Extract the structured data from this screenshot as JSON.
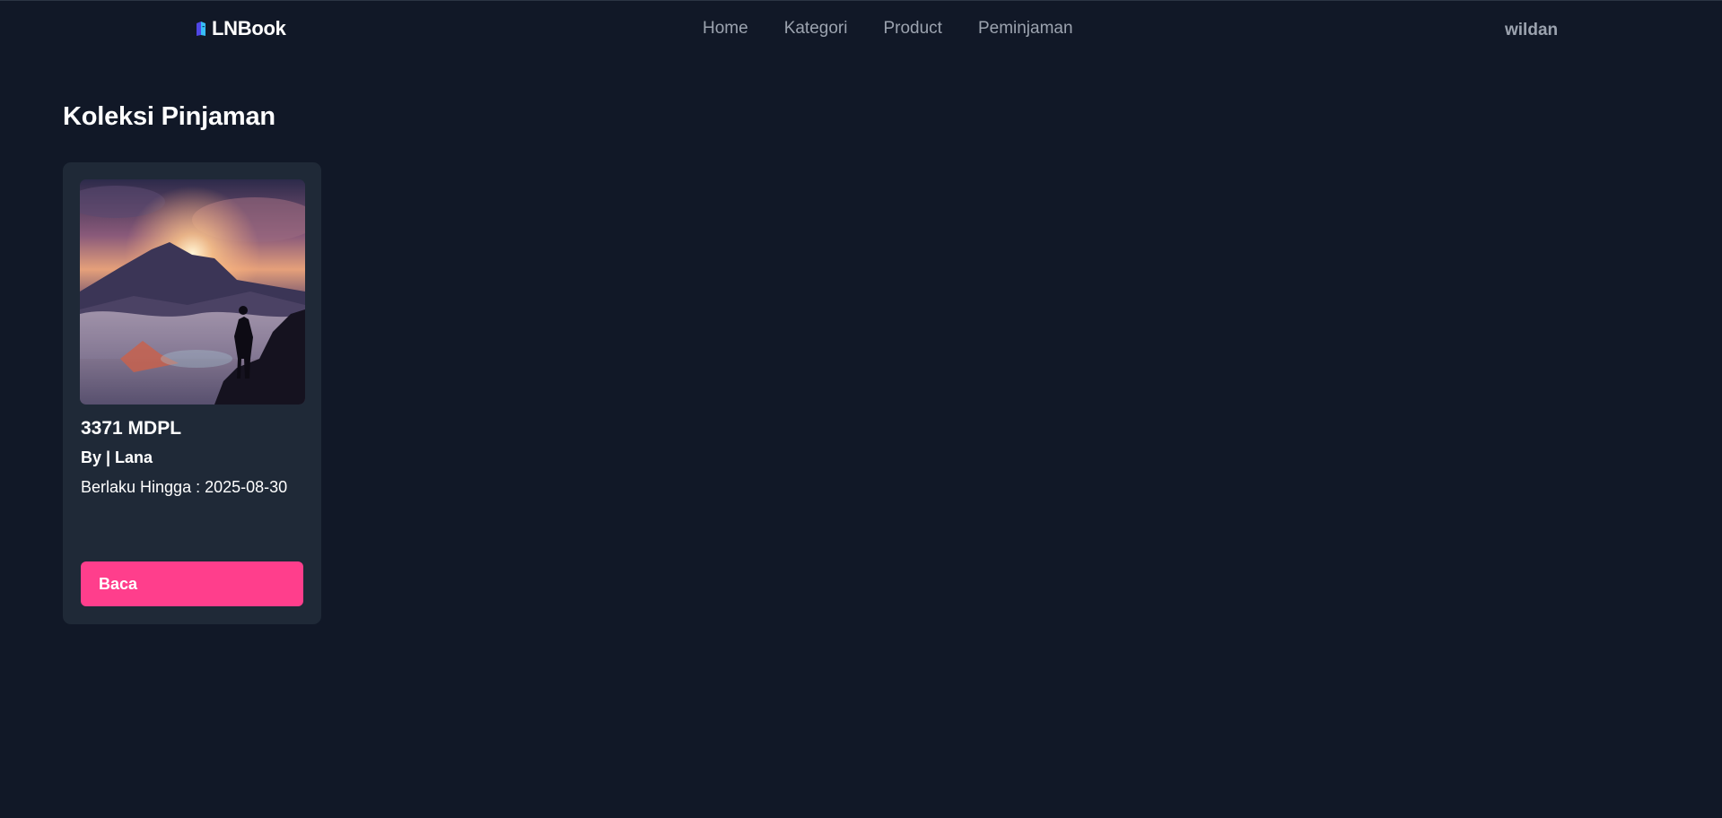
{
  "navbar": {
    "brand": "LNBook",
    "brand_icon": "book-icon",
    "links": [
      "Home",
      "Kategori",
      "Product",
      "Peminjaman"
    ],
    "user": "wildan"
  },
  "main": {
    "title": "Koleksi Pinjaman",
    "cards": [
      {
        "title": "3371 MDPL",
        "author": "By | Lana",
        "valid_until": "Berlaku Hingga : 2025-08-30",
        "button": "Baca"
      }
    ]
  },
  "colors": {
    "background": "#111827",
    "card": "#1f2937",
    "accent": "#ff3e8c",
    "nav_text": "#9ca3af"
  }
}
